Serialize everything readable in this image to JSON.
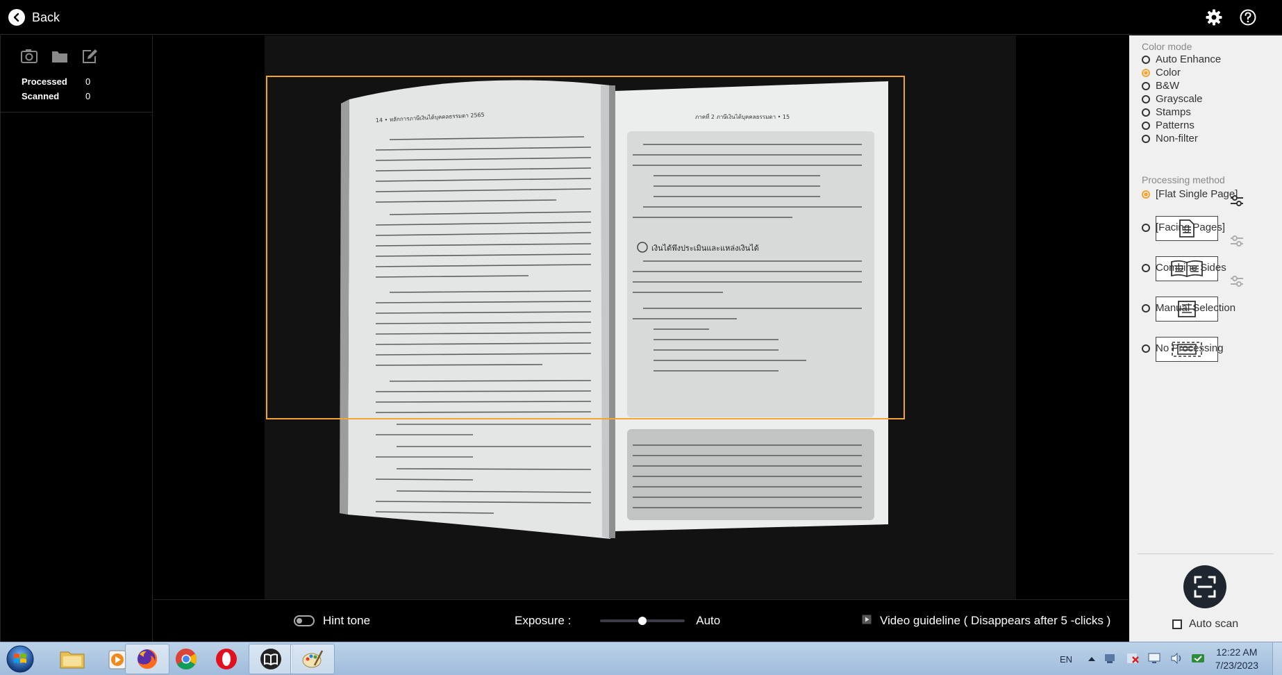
{
  "topbar": {
    "back_label": "Back",
    "icons": [
      "back-arrow-icon",
      "gear-icon",
      "help-icon"
    ]
  },
  "left_panel": {
    "icons": [
      "camera-settings-icon",
      "folder-icon",
      "edit-icon"
    ],
    "processed_label": "Processed",
    "processed_value": "0",
    "scanned_label": "Scanned",
    "scanned_value": "0"
  },
  "preview": {
    "book_left_header": "14  •  หลักการภาษีเงินได้บุคคลธรรมดา 2565",
    "book_right_header": "ภาคที่ 2  ภาษีเงินได้บุคคลธรรมดา  •  15",
    "book_right_heading": "เงินได้พึงประเมินและแหล่งเงินได้",
    "crop_color": "#f2a531"
  },
  "bottombar": {
    "hint_label": "Hint tone",
    "exposure_label": "Exposure :",
    "exposure_value_fraction": 0.5,
    "auto_label": "Auto",
    "video_label": "Video guideline ( Disappears after 5 -clicks )"
  },
  "right_panel": {
    "color_mode_title": "Color mode",
    "color_modes": [
      "Auto Enhance",
      "Color",
      "B&W",
      "Grayscale",
      "Stamps",
      "Patterns",
      "Non-filter"
    ],
    "color_mode_selected": "Color",
    "processing_title": "Processing method",
    "processing_methods": [
      "[Flat Single Page]",
      "[Facing Pages]",
      "Combine Sides",
      "Manual Selection",
      "No Processing"
    ],
    "processing_selected": "[Flat Single Page]",
    "scan_icon": "scan-frame-icon",
    "autoscan_label": "Auto scan"
  },
  "taskbar": {
    "apps": [
      "file-explorer-icon",
      "media-player-icon",
      "firefox-icon",
      "chrome-icon",
      "opera-icon",
      "scanner-app-icon",
      "paint-icon"
    ],
    "lang": "EN",
    "time": "12:22 AM",
    "date": "7/23/2023"
  }
}
